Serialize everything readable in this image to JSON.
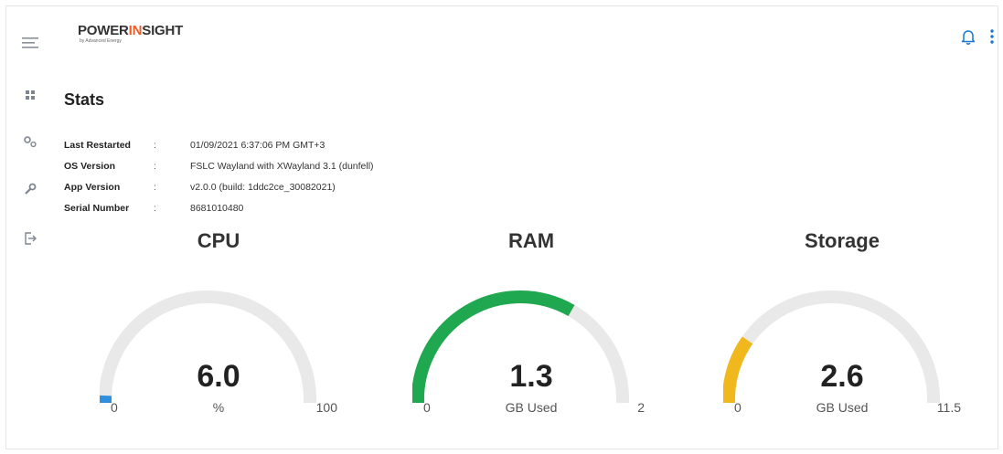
{
  "app": {
    "logo_left": "POWER",
    "logo_accent": "IN",
    "logo_right": "SIGHT",
    "logo_sub": "by Advanced Energy",
    "accent_color": "#f15a22"
  },
  "sidebar": {
    "items": [
      {
        "name": "menu",
        "icon": "hamburger-icon"
      },
      {
        "name": "dashboard",
        "icon": "grid-icon"
      },
      {
        "name": "settings",
        "icon": "gears-icon"
      },
      {
        "name": "tools",
        "icon": "wrench-icon"
      },
      {
        "name": "logout",
        "icon": "logout-icon"
      }
    ]
  },
  "header": {
    "notification_icon": "bell-icon",
    "more_icon": "more-vertical-icon",
    "icon_color": "#1976d2"
  },
  "page": {
    "title": "Stats"
  },
  "info": [
    {
      "label": "Last Restarted",
      "sep": ":",
      "value": "01/09/2021 6:37:06 PM GMT+3"
    },
    {
      "label": "OS Version",
      "sep": ":",
      "value": "FSLC Wayland with XWayland 3.1 (dunfell)"
    },
    {
      "label": "App Version",
      "sep": ":",
      "value": "v2.0.0 (build: 1ddc2ce_30082021)"
    },
    {
      "label": "Serial Number",
      "sep": ":",
      "value": "8681010480"
    }
  ],
  "gauges": [
    {
      "title": "CPU",
      "value": "6.0",
      "unit": "%",
      "min": "0",
      "max": "100",
      "fraction": 0.06,
      "color": "#2f8fdc"
    },
    {
      "title": "RAM",
      "value": "1.3",
      "unit": "GB Used",
      "min": "0",
      "max": "2",
      "fraction": 0.65,
      "color": "#1fa84f"
    },
    {
      "title": "Storage",
      "value": "2.6",
      "unit": "GB Used",
      "min": "0",
      "max": "11.5",
      "fraction": 0.226,
      "color": "#f0b81c"
    }
  ],
  "gauge_track_color": "#e9e9e9"
}
